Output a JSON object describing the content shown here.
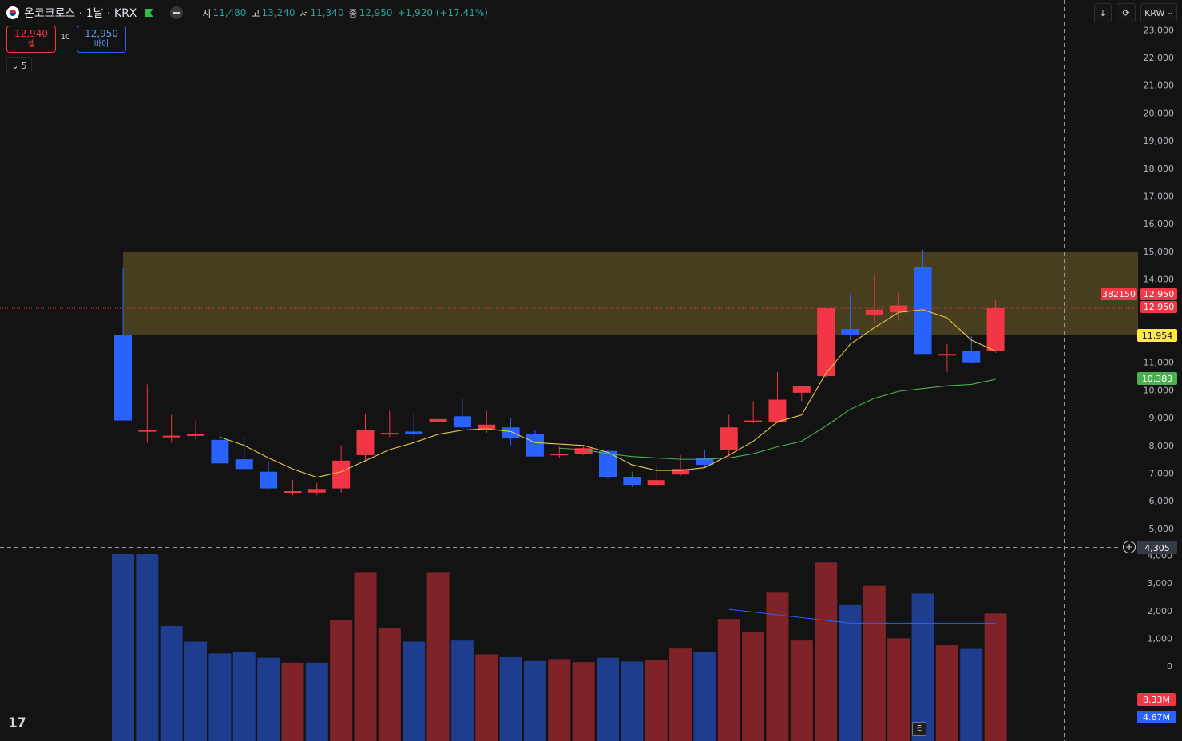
{
  "header": {
    "symbol_title": "온코크로스 · 1날 · KRX",
    "open_label": "시",
    "open_value": "11,480",
    "high_label": "고",
    "high_value": "13,240",
    "low_label": "저",
    "low_value": "11,340",
    "close_label": "종",
    "close_value": "12,950",
    "change": "+1,920 (+17.41%)"
  },
  "trade": {
    "sell_price": "12,940",
    "sell_label": "셀",
    "spread": "10",
    "buy_price": "12,950",
    "buy_label": "바이"
  },
  "indicator_toggle": {
    "label": "5"
  },
  "toolbar": {
    "currency_label": "KRW"
  },
  "logo_text": "17",
  "events": {
    "earnings_badge": "E"
  },
  "colors": {
    "background": "#131313",
    "up": "#f23645",
    "down": "#2962ff",
    "ma_fast": "#e6c94a",
    "ma_slow": "#4caf50",
    "zone": "#4d4420",
    "vol_up": "#7f2329",
    "vol_down": "#1e3d8f"
  },
  "chart_data": [
    {
      "type": "candlestick",
      "currency": "KRW",
      "price_axis_ticks": [
        5000,
        6000,
        7000,
        8000,
        9000,
        10000,
        11000,
        12000,
        13000,
        14000,
        15000,
        16000,
        17000,
        18000,
        19000,
        20000,
        21000,
        22000,
        23000
      ],
      "candles": [
        {
          "o": 12000,
          "h": 14400,
          "l": 8900,
          "c": 8900
        },
        {
          "o": 8500,
          "h": 10200,
          "l": 8100,
          "c": 8550
        },
        {
          "o": 8350,
          "h": 9100,
          "l": 8100,
          "c": 8350
        },
        {
          "o": 8350,
          "h": 8900,
          "l": 8200,
          "c": 8400
        },
        {
          "o": 8200,
          "h": 8500,
          "l": 7400,
          "c": 7350
        },
        {
          "o": 7500,
          "h": 8300,
          "l": 7100,
          "c": 7150
        },
        {
          "o": 7050,
          "h": 7400,
          "l": 6400,
          "c": 6450
        },
        {
          "o": 6300,
          "h": 6750,
          "l": 6200,
          "c": 6350
        },
        {
          "o": 6300,
          "h": 6650,
          "l": 6200,
          "c": 6400
        },
        {
          "o": 6450,
          "h": 8000,
          "l": 6300,
          "c": 7450
        },
        {
          "o": 7650,
          "h": 9150,
          "l": 7400,
          "c": 8550
        },
        {
          "o": 8400,
          "h": 9250,
          "l": 8300,
          "c": 8450
        },
        {
          "o": 8500,
          "h": 9150,
          "l": 8200,
          "c": 8400
        },
        {
          "o": 8850,
          "h": 10050,
          "l": 8750,
          "c": 8950
        },
        {
          "o": 9050,
          "h": 9700,
          "l": 8600,
          "c": 8650
        },
        {
          "o": 8600,
          "h": 9250,
          "l": 8450,
          "c": 8750
        },
        {
          "o": 8650,
          "h": 9000,
          "l": 8000,
          "c": 8250
        },
        {
          "o": 8400,
          "h": 8550,
          "l": 7600,
          "c": 7600
        },
        {
          "o": 7700,
          "h": 7950,
          "l": 7550,
          "c": 7700
        },
        {
          "o": 7700,
          "h": 8000,
          "l": 7650,
          "c": 7900
        },
        {
          "o": 7800,
          "h": 7850,
          "l": 6800,
          "c": 6850
        },
        {
          "o": 6850,
          "h": 7050,
          "l": 6500,
          "c": 6550
        },
        {
          "o": 6550,
          "h": 7250,
          "l": 6500,
          "c": 6750
        },
        {
          "o": 6950,
          "h": 7650,
          "l": 6900,
          "c": 7150
        },
        {
          "o": 7550,
          "h": 7850,
          "l": 7200,
          "c": 7300
        },
        {
          "o": 7850,
          "h": 9100,
          "l": 7600,
          "c": 8650
        },
        {
          "o": 8850,
          "h": 9600,
          "l": 8800,
          "c": 8900
        },
        {
          "o": 8850,
          "h": 10650,
          "l": 8800,
          "c": 9650
        },
        {
          "o": 9900,
          "h": 10100,
          "l": 9600,
          "c": 10150
        },
        {
          "o": 10500,
          "h": 12950,
          "l": 10450,
          "c": 12950
        },
        {
          "o": 12200,
          "h": 13450,
          "l": 11800,
          "c": 12000
        },
        {
          "o": 12700,
          "h": 14200,
          "l": 12400,
          "c": 12900
        },
        {
          "o": 12800,
          "h": 13500,
          "l": 12500,
          "c": 13050
        },
        {
          "o": 14450,
          "h": 15050,
          "l": 11300,
          "c": 11300
        },
        {
          "o": 11300,
          "h": 11650,
          "l": 10650,
          "c": 11300
        },
        {
          "o": 11400,
          "h": 11950,
          "l": 10950,
          "c": 11000
        },
        {
          "o": 11400,
          "h": 13240,
          "l": 11340,
          "c": 12950
        }
      ],
      "moving_averages": [
        {
          "period": 5,
          "color": "#e6c94a",
          "values": [
            null,
            null,
            null,
            null,
            8300,
            8000,
            7550,
            7150,
            6850,
            7050,
            7450,
            7850,
            8100,
            8400,
            8550,
            8600,
            8500,
            8100,
            8050,
            8000,
            7750,
            7300,
            7100,
            7100,
            7200,
            7650,
            8150,
            8850,
            9100,
            10600,
            11650,
            12250,
            12800,
            12900,
            12600,
            11800,
            11400
          ]
        },
        {
          "period": 20,
          "color": "#4caf50",
          "values": [
            null,
            null,
            null,
            null,
            null,
            null,
            null,
            null,
            null,
            null,
            null,
            null,
            null,
            null,
            null,
            null,
            null,
            null,
            7900,
            7850,
            7700,
            7600,
            7550,
            7500,
            7500,
            7550,
            7700,
            7950,
            8150,
            8700,
            9300,
            9700,
            9950,
            10050,
            10150,
            10200,
            10383
          ]
        }
      ],
      "price_labels": [
        {
          "value": "382150",
          "color": "#f23645"
        },
        {
          "value": "12,950",
          "color": "#f23645"
        },
        {
          "value": "12,950",
          "color": "#f23645"
        },
        {
          "value": "11,954",
          "color": "#ffeb3b"
        },
        {
          "value": "10,383",
          "color": "#4caf50"
        },
        {
          "value": "4,305",
          "color": "#363a45"
        }
      ],
      "zone": {
        "from": 12000,
        "to": 15000,
        "start_index": 0
      }
    },
    {
      "type": "bar",
      "title": "Volume",
      "axis_ticks": [
        "0",
        "1,000",
        "2,000",
        "3,000",
        "4,000"
      ],
      "values": [
        10200,
        4050,
        1450,
        880,
        450,
        520,
        300,
        120,
        120,
        1650,
        3400,
        1370,
        880,
        3400,
        920,
        420,
        320,
        180,
        250,
        140,
        300,
        160,
        220,
        630,
        520,
        1700,
        1220,
        2650,
        920,
        3750,
        2200,
        2900,
        1000,
        2620,
        750,
        620,
        1900
      ],
      "direction": [
        "down",
        "down",
        "down",
        "down",
        "down",
        "down",
        "down",
        "up",
        "down",
        "up",
        "up",
        "up",
        "down",
        "up",
        "down",
        "up",
        "down",
        "down",
        "up",
        "up",
        "down",
        "down",
        "up",
        "up",
        "down",
        "up",
        "up",
        "up",
        "up",
        "up",
        "down",
        "up",
        "up",
        "down",
        "up",
        "down",
        "up"
      ],
      "ma_line": {
        "color": "#2962ff",
        "values": [
          2050,
          1950,
          1850,
          1750,
          1650,
          1550,
          1550,
          1550,
          1550,
          1550,
          1550,
          1550
        ]
      },
      "labels": [
        {
          "value": "8.33M",
          "color": "#f23645"
        },
        {
          "value": "4.67M",
          "color": "#2962ff"
        }
      ]
    }
  ]
}
